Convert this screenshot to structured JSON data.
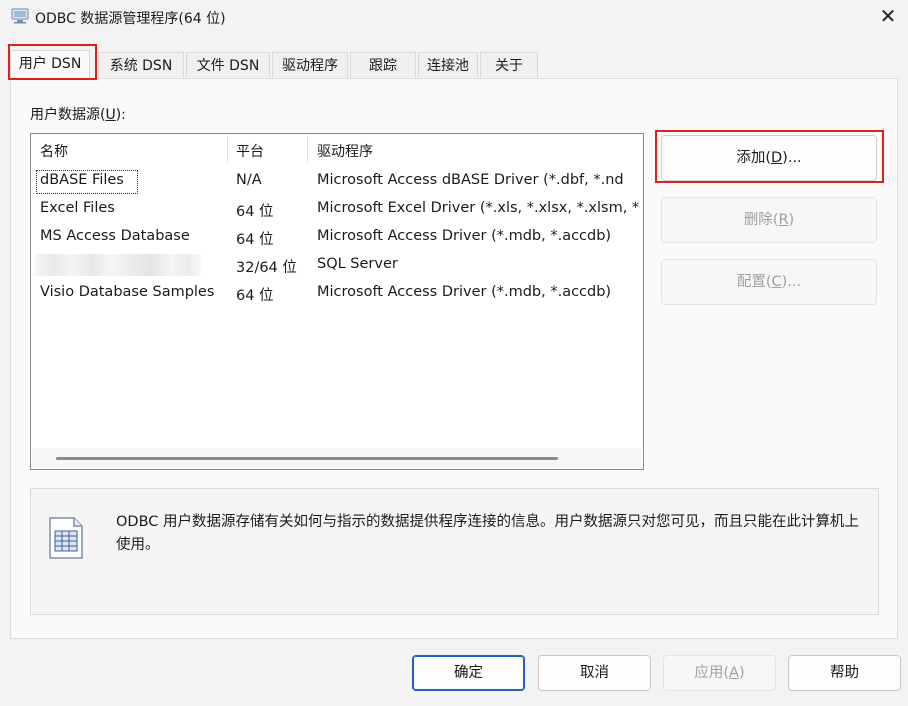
{
  "window": {
    "title": "ODBC 数据源管理程序(64 位)",
    "close_glyph": "✕"
  },
  "tabs": [
    "用户 DSN",
    "系统 DSN",
    "文件 DSN",
    "驱动程序",
    "跟踪",
    "连接池",
    "关于"
  ],
  "active_tab": "用户 DSN",
  "group": {
    "label": "用户数据源(",
    "accel": "U",
    "suffix": "):"
  },
  "columns": [
    "名称",
    "平台",
    "驱动程序"
  ],
  "rows": [
    {
      "name": "dBASE Files",
      "platform": "N/A",
      "driver": "Microsoft Access dBASE Driver (*.dbf, *.nd"
    },
    {
      "name": "Excel Files",
      "platform": "64 位",
      "driver": "Microsoft Excel Driver (*.xls, *.xlsx, *.xlsm, *"
    },
    {
      "name": "MS Access Database",
      "platform": "64 位",
      "driver": "Microsoft Access Driver (*.mdb, *.accdb)"
    },
    {
      "name": "",
      "platform": "32/64 位",
      "driver": "SQL Server"
    },
    {
      "name": "Visio Database Samples",
      "platform": "64 位",
      "driver": "Microsoft Access Driver (*.mdb, *.accdb)"
    }
  ],
  "side_buttons": {
    "add": {
      "label": "添加(",
      "accel": "D",
      "suffix": ")..."
    },
    "remove": {
      "label": "删除(",
      "accel": "R",
      "suffix": ")"
    },
    "configure": {
      "label": "配置(",
      "accel": "C",
      "suffix": ")..."
    }
  },
  "info": {
    "text": "ODBC 用户数据源存储有关如何与指示的数据提供程序连接的信息。用户数据源只对您可见，而且只能在此计算机上使用。",
    "icon": "data-source-icon"
  },
  "footer": {
    "ok": "确定",
    "cancel": "取消",
    "apply": {
      "label": "应用(",
      "accel": "A",
      "suffix": ")"
    },
    "help": "帮助"
  },
  "colors": {
    "highlight_red": "#e0201c",
    "default_button_blue": "#1f5fbf"
  }
}
